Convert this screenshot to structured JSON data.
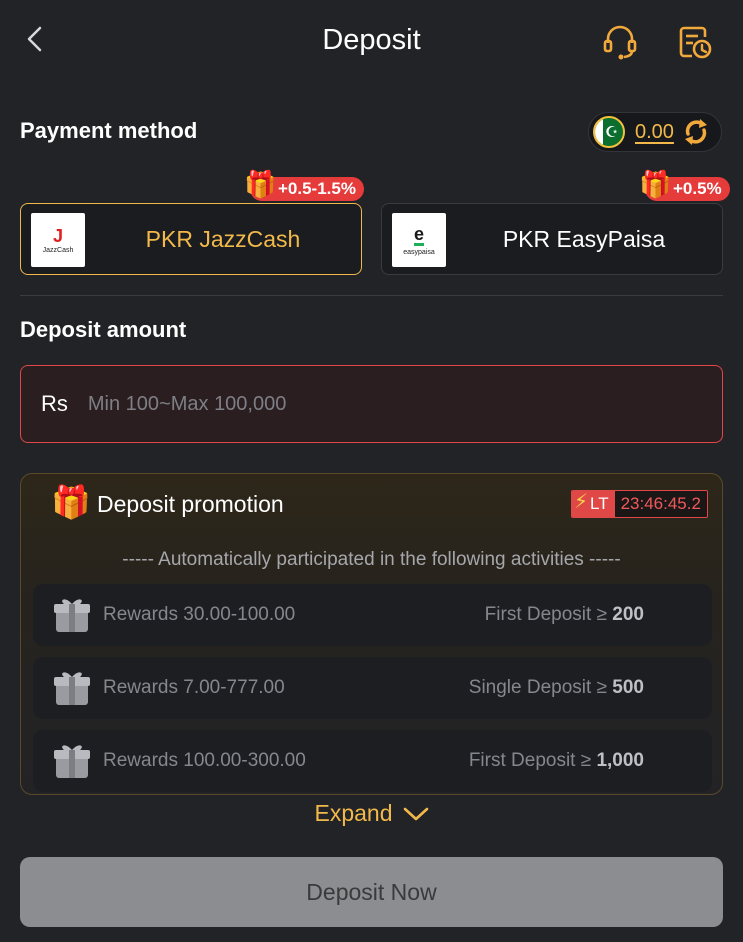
{
  "header": {
    "title": "Deposit"
  },
  "payment": {
    "title": "Payment method",
    "balance": "0.00",
    "methods": [
      {
        "label": "PKR JazzCash",
        "bonus": "+0.5-1.5%",
        "logo_text": "JazzCash",
        "logo_mark": "J",
        "selected": true
      },
      {
        "label": "PKR EasyPaisa",
        "bonus": "+0.5%",
        "logo_text": "easypaisa",
        "logo_mark": "e",
        "selected": false
      }
    ]
  },
  "amount": {
    "title": "Deposit amount",
    "currency": "Rs",
    "placeholder": "Min 100~Max 100,000"
  },
  "promotion": {
    "title": "Deposit promotion",
    "lt_label": "LT",
    "timer": "23:46:45.2",
    "subtitle": "----- Automatically participated in the following activities -----",
    "rows": [
      {
        "reward": "Rewards 30.00-100.00",
        "condition": "First Deposit ≥",
        "threshold": "200"
      },
      {
        "reward": "Rewards 7.00-777.00",
        "condition": "Single Deposit ≥",
        "threshold": "500"
      },
      {
        "reward": "Rewards 100.00-300.00",
        "condition": "First Deposit ≥",
        "threshold": "1,000"
      }
    ]
  },
  "expand_label": "Expand",
  "deposit_button": "Deposit Now",
  "colors": {
    "accent": "#f2b94a",
    "danger": "#e04848",
    "background": "#222327"
  },
  "icons": [
    "chevron-left-icon",
    "headset-icon",
    "records-clock-icon",
    "pakistan-flag-icon",
    "refresh-icon",
    "gift-icon",
    "lightning-icon",
    "chevron-down-icon"
  ]
}
